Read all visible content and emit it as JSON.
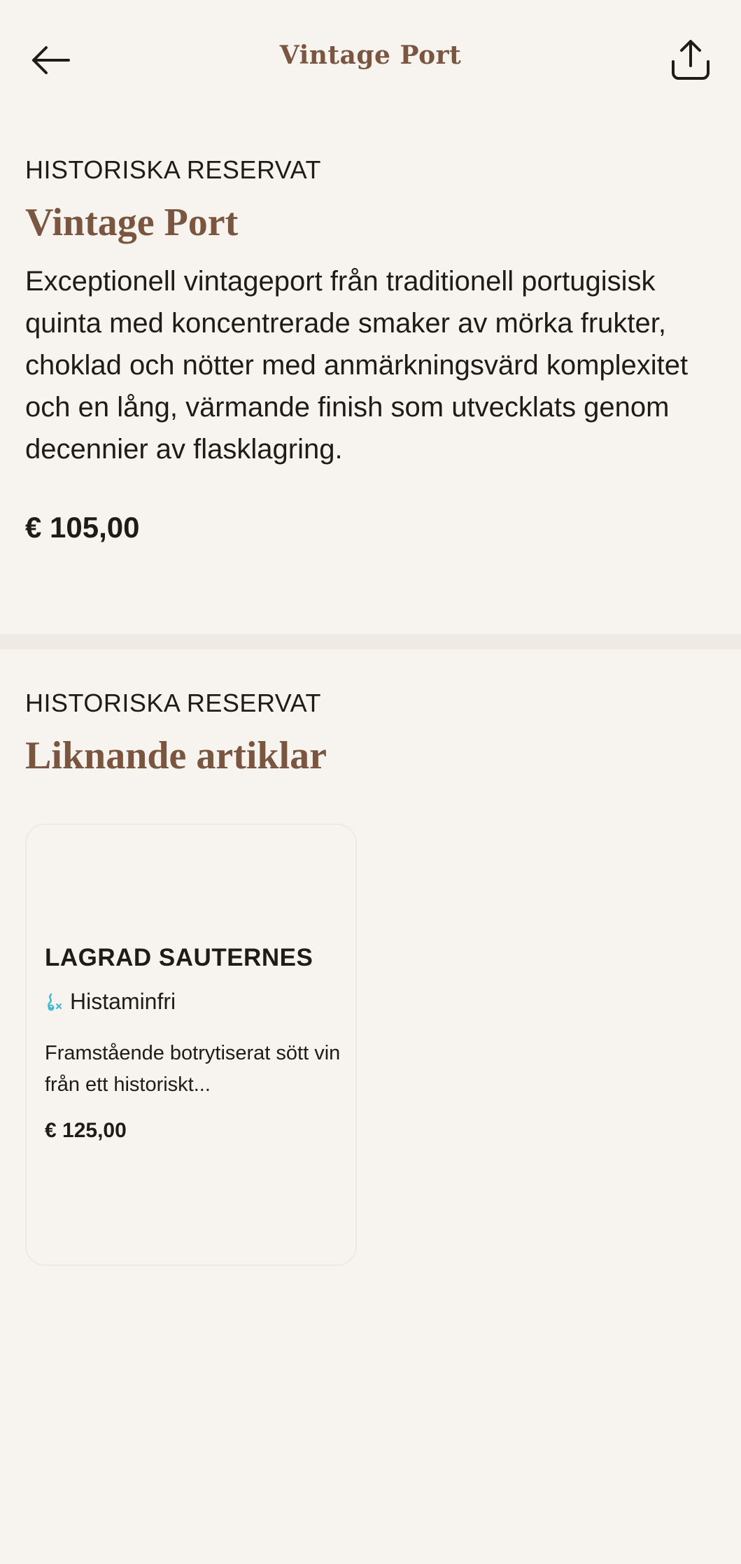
{
  "header": {
    "title": "Vintage Port"
  },
  "product": {
    "category": "HISTORISKA RESERVAT",
    "name": "Vintage Port",
    "description": "Exceptionell vintageport från traditionell portugisisk quinta med koncentrerade smaker av mörka frukter, choklad och nötter med anmärkningsvärd komplexitet och en lång, värmande finish som utvecklats genom decennier av flasklagring.",
    "price": "€ 105,00"
  },
  "similar": {
    "category": "HISTORISKA RESERVAT",
    "title": "Liknande artiklar",
    "items": [
      {
        "name": "LAGRAD SAUTERNES",
        "badge": "Histaminfri",
        "description": "Framstående botrytiserat sött vin från ett historiskt...",
        "price": "€ 125,00"
      }
    ]
  },
  "icons": {
    "back": "arrow-left-icon",
    "share": "share-icon",
    "badge": "histamine-free-icon"
  },
  "colors": {
    "accent": "#7a5640",
    "background": "#f7f4ef",
    "text": "#1f1b16",
    "badge_icon": "#3fb8d0"
  }
}
